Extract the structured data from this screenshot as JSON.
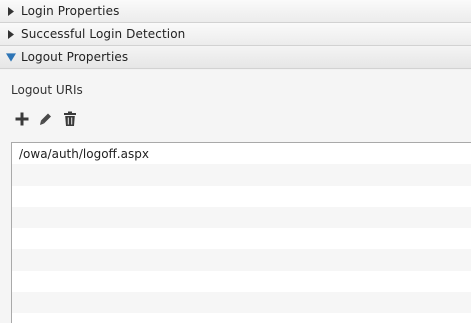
{
  "sections": [
    {
      "title": "Login Properties",
      "expanded": false
    },
    {
      "title": "Successful Login Detection",
      "expanded": false
    },
    {
      "title": "Logout Properties",
      "expanded": true
    }
  ],
  "logout": {
    "label": "Logout URIs",
    "toolbar": {
      "add_icon": "plus-icon",
      "edit_icon": "pencil-icon",
      "delete_icon": "trash-icon"
    },
    "uris": [
      "/owa/auth/logoff.aspx",
      "",
      "",
      "",
      "",
      "",
      "",
      "",
      ""
    ]
  },
  "colors": {
    "accent_arrow": "#2e75b6"
  }
}
